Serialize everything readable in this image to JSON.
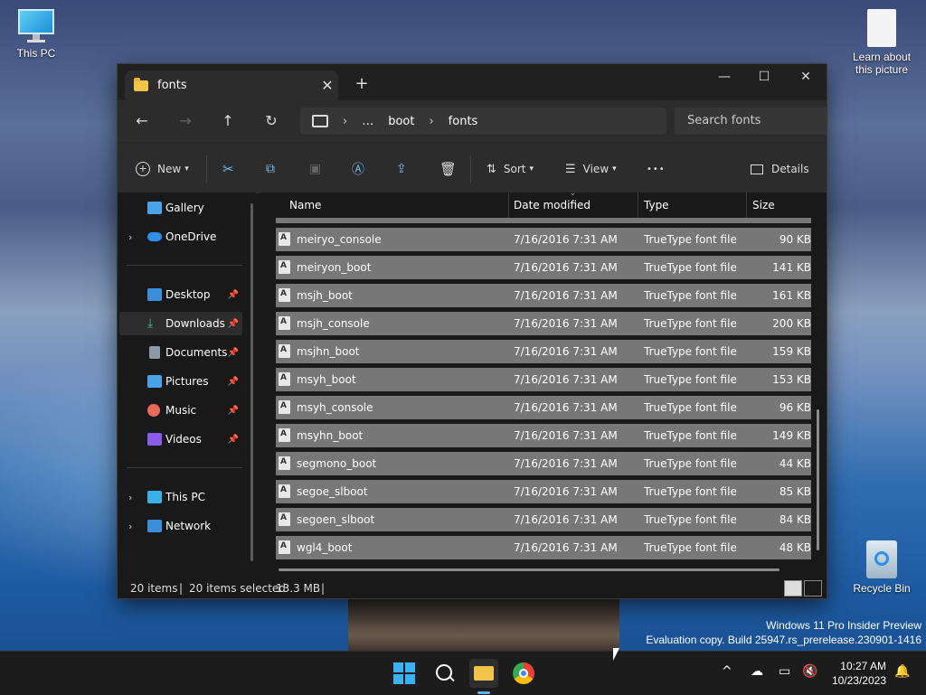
{
  "desktop": {
    "icons": [
      {
        "label": "This PC"
      },
      {
        "label": "Learn about this picture"
      },
      {
        "label": "Recycle Bin"
      }
    ],
    "watermark_line1": "Windows 11 Pro Insider Preview",
    "watermark_line2": "Evaluation copy. Build 25947.rs_prerelease.230901-1416"
  },
  "window": {
    "tab_title": "fonts",
    "tab_close": "✕",
    "new_tab": "+",
    "controls": {
      "minimize": "—",
      "maximize": "☐",
      "close": "✕"
    }
  },
  "navbar": {
    "back": "←",
    "forward": "→",
    "up": "↑",
    "refresh": "↻",
    "breadcrumb": [
      "…",
      "boot",
      "fonts"
    ],
    "search_placeholder": "Search fonts"
  },
  "toolbar": {
    "new_label": "New",
    "sort_label": "Sort",
    "view_label": "View",
    "more_label": "•••",
    "details_label": "Details"
  },
  "sidebar": {
    "items": [
      {
        "label": "Gallery",
        "color": "#4aa3e8"
      },
      {
        "label": "OneDrive",
        "color": "#2f8fe8"
      },
      {
        "label": "Desktop",
        "color": "#3a8fd8"
      },
      {
        "label": "Downloads",
        "color": "#3cbf8a"
      },
      {
        "label": "Documents",
        "color": "#8a9aa8"
      },
      {
        "label": "Pictures",
        "color": "#4aa3e8"
      },
      {
        "label": "Music",
        "color": "#e86a5a"
      },
      {
        "label": "Videos",
        "color": "#8a5ae8"
      },
      {
        "label": "This PC",
        "color": "#3ab0e8"
      },
      {
        "label": "Network",
        "color": "#3a8fd8"
      }
    ]
  },
  "columns": {
    "name": "Name",
    "date": "Date modified",
    "type": "Type",
    "size": "Size"
  },
  "files": [
    {
      "name": "meiryo_console",
      "date": "7/16/2016 7:31 AM",
      "type": "TrueType font file",
      "size": "90 KB"
    },
    {
      "name": "meiryon_boot",
      "date": "7/16/2016 7:31 AM",
      "type": "TrueType font file",
      "size": "141 KB"
    },
    {
      "name": "msjh_boot",
      "date": "7/16/2016 7:31 AM",
      "type": "TrueType font file",
      "size": "161 KB"
    },
    {
      "name": "msjh_console",
      "date": "7/16/2016 7:31 AM",
      "type": "TrueType font file",
      "size": "200 KB"
    },
    {
      "name": "msjhn_boot",
      "date": "7/16/2016 7:31 AM",
      "type": "TrueType font file",
      "size": "159 KB"
    },
    {
      "name": "msyh_boot",
      "date": "7/16/2016 7:31 AM",
      "type": "TrueType font file",
      "size": "153 KB"
    },
    {
      "name": "msyh_console",
      "date": "7/16/2016 7:31 AM",
      "type": "TrueType font file",
      "size": "96 KB"
    },
    {
      "name": "msyhn_boot",
      "date": "7/16/2016 7:31 AM",
      "type": "TrueType font file",
      "size": "149 KB"
    },
    {
      "name": "segmono_boot",
      "date": "7/16/2016 7:31 AM",
      "type": "TrueType font file",
      "size": "44 KB"
    },
    {
      "name": "segoe_slboot",
      "date": "7/16/2016 7:31 AM",
      "type": "TrueType font file",
      "size": "85 KB"
    },
    {
      "name": "segoen_slboot",
      "date": "7/16/2016 7:31 AM",
      "type": "TrueType font file",
      "size": "84 KB"
    },
    {
      "name": "wgl4_boot",
      "date": "7/16/2016 7:31 AM",
      "type": "TrueType font file",
      "size": "48 KB"
    }
  ],
  "status": {
    "item_count": "20 items",
    "selected": "20 items selected",
    "size": "13.3 MB",
    "sep": "|"
  },
  "taskbar": {
    "time": "10:27 AM",
    "date": "10/23/2023",
    "tray_chevron": "^"
  }
}
